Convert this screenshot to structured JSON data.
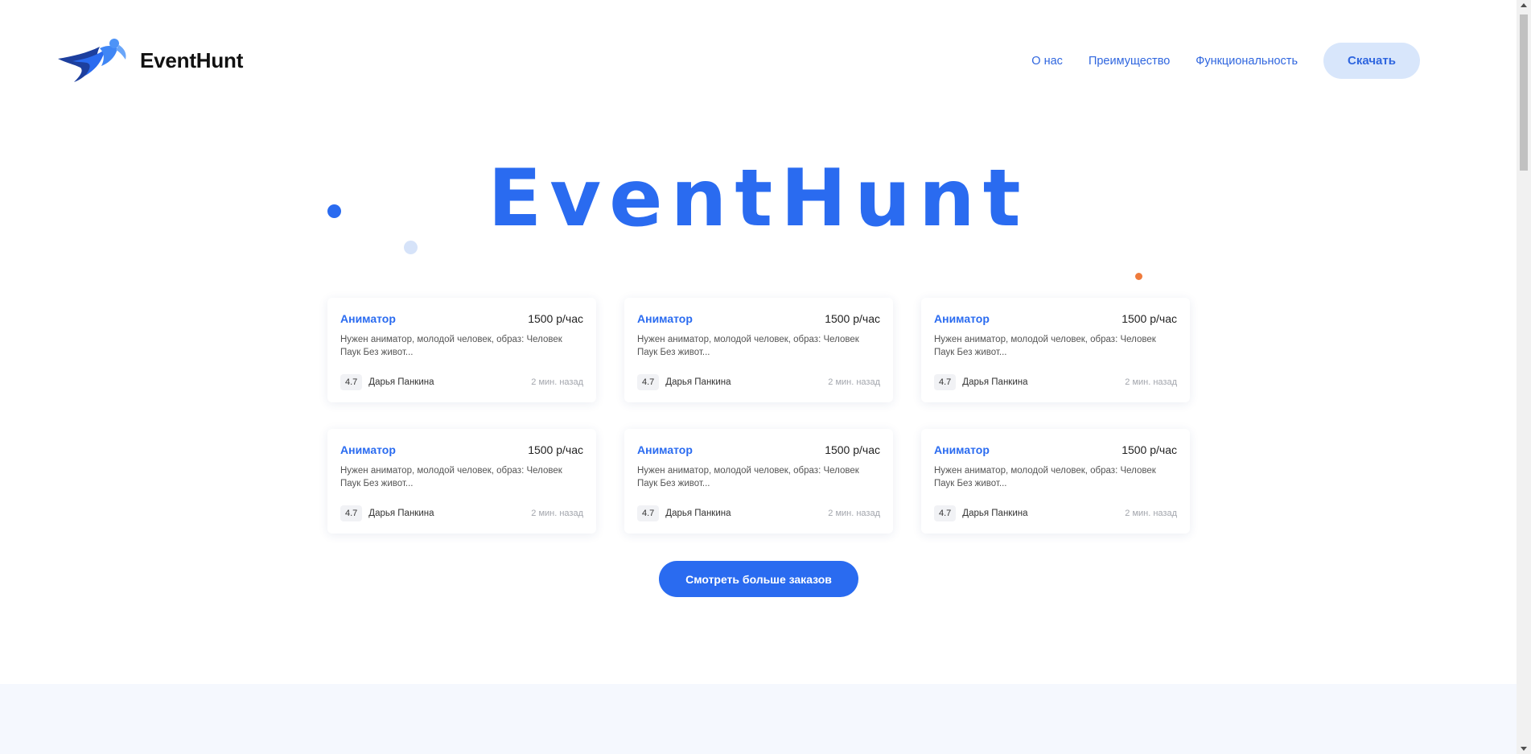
{
  "brand": {
    "name": "EventHunt",
    "logo_icon": "flying-hero-logo-icon",
    "primary_color": "#2a6bf0",
    "secondary_color": "#d8e6fb"
  },
  "nav": {
    "links": [
      {
        "label": "О нас"
      },
      {
        "label": "Преимущество"
      },
      {
        "label": "Функциональность"
      }
    ],
    "download_label": "Скачать"
  },
  "hero": {
    "title": "EventHunt"
  },
  "cards": [
    {
      "title": "Аниматор",
      "price": "1500 р/час",
      "description": "Нужен аниматор, молодой человек, образ: Человек Паук Без живот...",
      "rating": "4.7",
      "author": "Дарья Панкина",
      "time": "2 мин. назад"
    },
    {
      "title": "Аниматор",
      "price": "1500 р/час",
      "description": "Нужен аниматор, молодой человек, образ: Человек Паук Без живот...",
      "rating": "4.7",
      "author": "Дарья Панкина",
      "time": "2 мин. назад"
    },
    {
      "title": "Аниматор",
      "price": "1500 р/час",
      "description": "Нужен аниматор, молодой человек, образ: Человек Паук Без живот...",
      "rating": "4.7",
      "author": "Дарья Панкина",
      "time": "2 мин. назад"
    },
    {
      "title": "Аниматор",
      "price": "1500 р/час",
      "description": "Нужен аниматор, молодой человек, образ: Человек Паук Без живот...",
      "rating": "4.7",
      "author": "Дарья Панкина",
      "time": "2 мин. назад"
    },
    {
      "title": "Аниматор",
      "price": "1500 р/час",
      "description": "Нужен аниматор, молодой человек, образ: Человек Паук Без живот...",
      "rating": "4.7",
      "author": "Дарья Панкина",
      "time": "2 мин. назад"
    },
    {
      "title": "Аниматор",
      "price": "1500 р/час",
      "description": "Нужен аниматор, молодой человек, образ: Человек Паук Без живот...",
      "rating": "4.7",
      "author": "Дарья Панкина",
      "time": "2 мин. назад"
    }
  ],
  "more_button": {
    "label": "Смотреть больше заказов"
  }
}
